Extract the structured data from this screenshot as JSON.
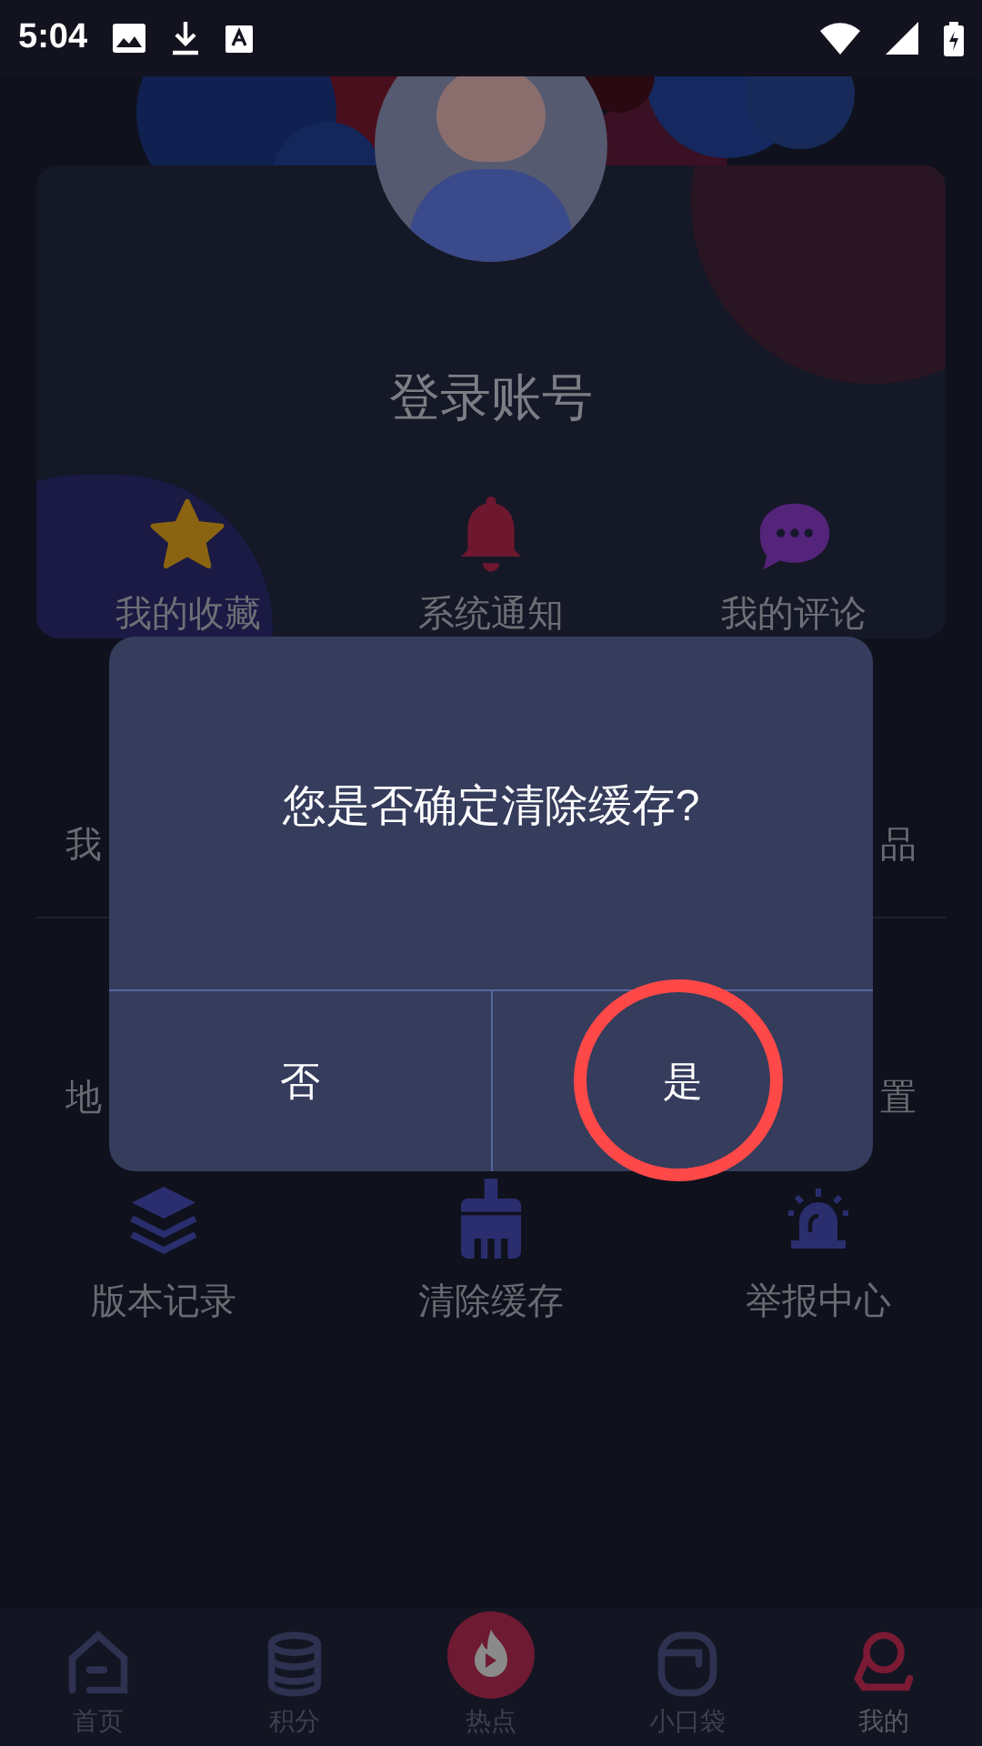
{
  "status_bar": {
    "time": "5:04"
  },
  "profile": {
    "login": "登录账号",
    "shortcuts": [
      {
        "kind": "star",
        "label": "我的收藏"
      },
      {
        "kind": "bell",
        "label": "系统通知"
      },
      {
        "kind": "chat",
        "label": "我的评论"
      }
    ]
  },
  "menu_rows": [
    {
      "left": "我",
      "right": "品"
    },
    {
      "left": "地",
      "right": "置"
    }
  ],
  "tools": [
    {
      "kind": "layers",
      "label": "版本记录"
    },
    {
      "kind": "broom",
      "label": "清除缓存"
    },
    {
      "kind": "siren",
      "label": "举报中心"
    }
  ],
  "dialog": {
    "message": "您是否确定清除缓存?",
    "buttons": [
      {
        "label": "否",
        "highlighted": false
      },
      {
        "label": "是",
        "highlighted": true
      }
    ]
  },
  "bottom_nav": [
    {
      "kind": "home",
      "label": "首页",
      "selected": false
    },
    {
      "kind": "coins",
      "label": "积分",
      "selected": false
    },
    {
      "kind": "hot",
      "label": "热点",
      "selected": false
    },
    {
      "kind": "pocket",
      "label": "小口袋",
      "selected": false
    },
    {
      "kind": "user",
      "label": "我的",
      "selected": true
    }
  ]
}
